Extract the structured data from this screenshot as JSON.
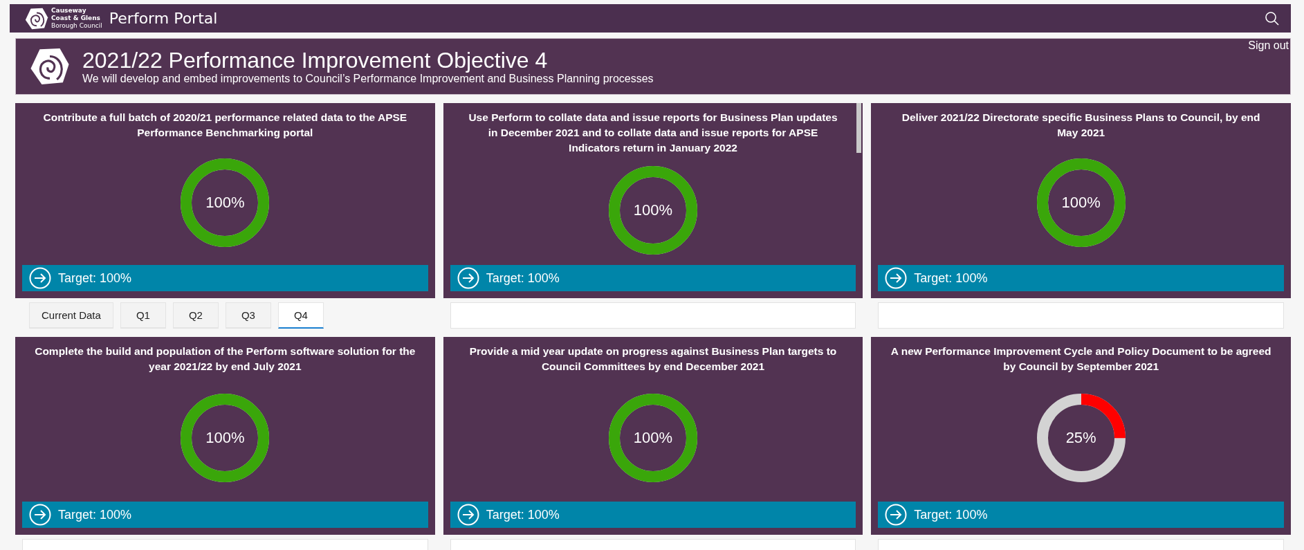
{
  "top_bar": {
    "logo_lines": [
      "Causeway",
      "Coast & Glens",
      "Borough Council"
    ],
    "title": "Perform Portal"
  },
  "header": {
    "title": "2021/22 Performance Improvement Objective 4",
    "subtitle": "We will develop and embed improvements to Council’s Performance Improvement and Business Planning processes",
    "sign_out": "Sign out"
  },
  "cards": [
    {
      "title": "Contribute a full batch of 2020/21 performance related data to the APSE Performance Benchmarking portal",
      "percent": "100%",
      "color": "#3aa60a",
      "target": "Target: 100%",
      "tabs": [
        {
          "label": "Current Data",
          "selected": false
        },
        {
          "label": "Q1",
          "selected": false
        },
        {
          "label": "Q2",
          "selected": false
        },
        {
          "label": "Q3",
          "selected": false
        },
        {
          "label": "Q4",
          "selected": true
        }
      ]
    },
    {
      "title": "Use Perform to collate data and issue reports for Business Plan updates in December 2021 and to collate data and issue reports for APSE Indicators return in January 2022",
      "percent": "100%",
      "color": "#3aa60a",
      "target": "Target: 100%"
    },
    {
      "title": "Deliver 2021/22 Directorate specific Business Plans to Council, by end May 2021",
      "percent": "100%",
      "color": "#3aa60a",
      "target": "Target: 100%"
    },
    {
      "title": "Complete the build and population of the Perform software solution for the year 2021/22 by end July 2021",
      "percent": "100%",
      "color": "#3aa60a",
      "target": "Target: 100%"
    },
    {
      "title": "Provide a mid year update on progress against Business Plan targets to Council Committees by end December 2021",
      "percent": "100%",
      "color": "#3aa60a",
      "target": "Target: 100%"
    },
    {
      "title": "A new Performance Improvement Cycle and Policy Document to be agreed by Council by September 2021",
      "percent": "25%",
      "color": "#ff0000",
      "target": "Target: 100%"
    }
  ]
}
